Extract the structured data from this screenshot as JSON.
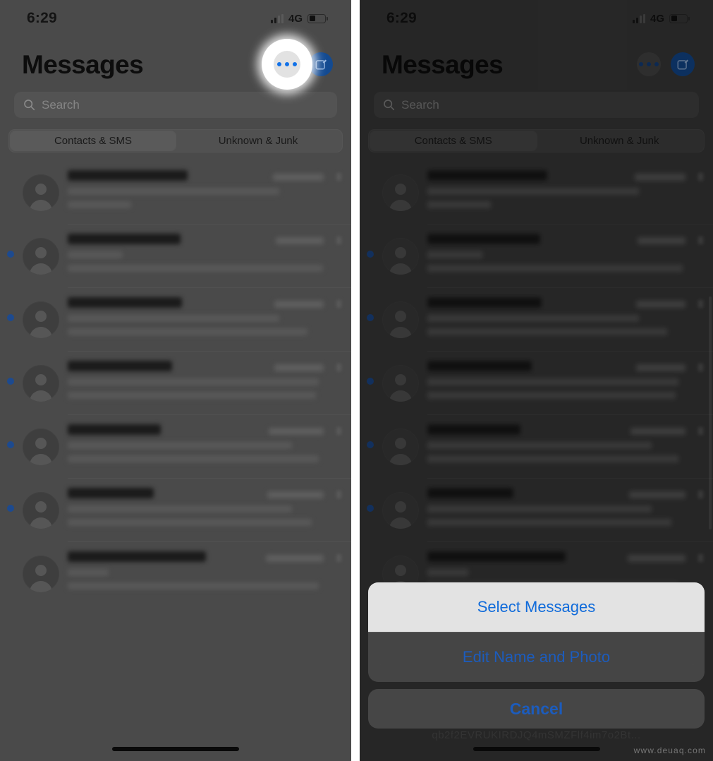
{
  "statusbar": {
    "time": "6:29",
    "network": "4G",
    "signal_icon": "cellular-bars-icon",
    "battery_icon": "battery-icon",
    "battery_level": 35
  },
  "header": {
    "title": "Messages",
    "more_icon": "ellipsis-icon",
    "compose_icon": "compose-icon",
    "more_accent": "#1272e8",
    "compose_bg": "#134a91"
  },
  "search": {
    "placeholder": "Search",
    "icon": "search-icon"
  },
  "tabs": {
    "items": [
      {
        "label": "Contacts & SMS",
        "active": true
      },
      {
        "label": "Unknown & Junk",
        "active": false
      }
    ]
  },
  "messages": {
    "note": "conversation rows are visually blurred / redacted in the screenshot",
    "rows": [
      {
        "unread": false,
        "title_w": 170,
        "time_w": 72,
        "line1_w": 300,
        "line2_w": 90,
        "avatar_icon": "person-avatar-icon"
      },
      {
        "unread": true,
        "title_w": 160,
        "time_w": 68,
        "line1_w": 78,
        "line2_w": 362,
        "avatar_icon": "person-avatar-icon"
      },
      {
        "unread": true,
        "title_w": 162,
        "time_w": 70,
        "line1_w": 300,
        "line2_w": 340,
        "avatar_icon": "person-avatar-icon"
      },
      {
        "unread": true,
        "title_w": 148,
        "time_w": 70,
        "line1_w": 356,
        "line2_w": 352,
        "avatar_icon": "person-avatar-icon"
      },
      {
        "unread": true,
        "title_w": 132,
        "time_w": 78,
        "line1_w": 318,
        "line2_w": 356,
        "avatar_icon": "person-avatar-icon"
      },
      {
        "unread": true,
        "title_w": 122,
        "time_w": 80,
        "line1_w": 318,
        "line2_w": 346,
        "avatar_icon": "person-avatar-icon"
      },
      {
        "unread": false,
        "title_w": 196,
        "time_w": 82,
        "line1_w": 58,
        "line2_w": 356,
        "avatar_icon": "person-avatar-icon"
      }
    ]
  },
  "action_sheet": {
    "items": [
      {
        "label": "Select Messages",
        "highlighted": true
      },
      {
        "label": "Edit Name and Photo",
        "highlighted": false
      }
    ],
    "cancel_label": "Cancel",
    "accent": "#1e62c9"
  },
  "obscured_text": "qb2f2EVRUKIRDJQ4mSMZFlf4im7o2Bt...",
  "watermark": "www.deuaq.com",
  "home_indicator": "home-indicator"
}
